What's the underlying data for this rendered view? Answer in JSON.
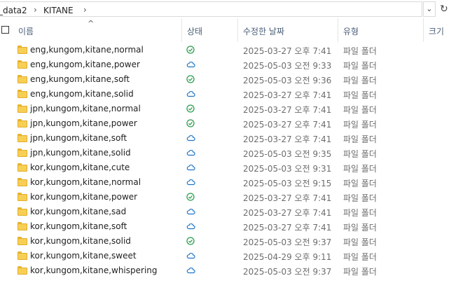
{
  "address": {
    "crumbs": [
      "_data2",
      "KITANE"
    ]
  },
  "columns": {
    "name": "이름",
    "status": "상태",
    "date": "수정한 날짜",
    "type": "유형",
    "size": "크기"
  },
  "colors": {
    "sync_ok": "#2e9e4f",
    "cloud": "#1d74c9",
    "folder": "#f8cf55"
  },
  "rows": [
    {
      "name": "eng,kungom,kitane,normal",
      "status": "synced",
      "date": "2025-03-27 오후 7:41",
      "type": "파일 폴더"
    },
    {
      "name": "eng,kungom,kitane,power",
      "status": "cloud",
      "date": "2025-05-03 오전 9:33",
      "type": "파일 폴더"
    },
    {
      "name": "eng,kungom,kitane,soft",
      "status": "synced",
      "date": "2025-05-03 오전 9:36",
      "type": "파일 폴더"
    },
    {
      "name": "eng,kungom,kitane,solid",
      "status": "cloud",
      "date": "2025-03-27 오후 7:41",
      "type": "파일 폴더"
    },
    {
      "name": "jpn,kungom,kitane,normal",
      "status": "synced",
      "date": "2025-03-27 오후 7:41",
      "type": "파일 폴더"
    },
    {
      "name": "jpn,kungom,kitane,power",
      "status": "synced",
      "date": "2025-03-27 오후 7:41",
      "type": "파일 폴더"
    },
    {
      "name": "jpn,kungom,kitane,soft",
      "status": "cloud",
      "date": "2025-03-27 오후 7:41",
      "type": "파일 폴더"
    },
    {
      "name": "jpn,kungom,kitane,solid",
      "status": "cloud",
      "date": "2025-05-03 오전 9:35",
      "type": "파일 폴더"
    },
    {
      "name": "kor,kungom,kitane,cute",
      "status": "cloud",
      "date": "2025-05-03 오전 9:31",
      "type": "파일 폴더"
    },
    {
      "name": "kor,kungom,kitane,normal",
      "status": "cloud",
      "date": "2025-05-03 오전 9:15",
      "type": "파일 폴더"
    },
    {
      "name": "kor,kungom,kitane,power",
      "status": "synced",
      "date": "2025-03-27 오후 7:41",
      "type": "파일 폴더"
    },
    {
      "name": "kor,kungom,kitane,sad",
      "status": "cloud",
      "date": "2025-03-27 오후 7:41",
      "type": "파일 폴더"
    },
    {
      "name": "kor,kungom,kitane,soft",
      "status": "cloud",
      "date": "2025-03-27 오후 7:41",
      "type": "파일 폴더"
    },
    {
      "name": "kor,kungom,kitane,solid",
      "status": "synced",
      "date": "2025-05-03 오전 9:37",
      "type": "파일 폴더"
    },
    {
      "name": "kor,kungom,kitane,sweet",
      "status": "cloud",
      "date": "2025-04-29 오후 9:11",
      "type": "파일 폴더"
    },
    {
      "name": "kor,kungom,kitane,whispering",
      "status": "cloud",
      "date": "2025-05-03 오전 9:37",
      "type": "파일 폴더"
    }
  ]
}
